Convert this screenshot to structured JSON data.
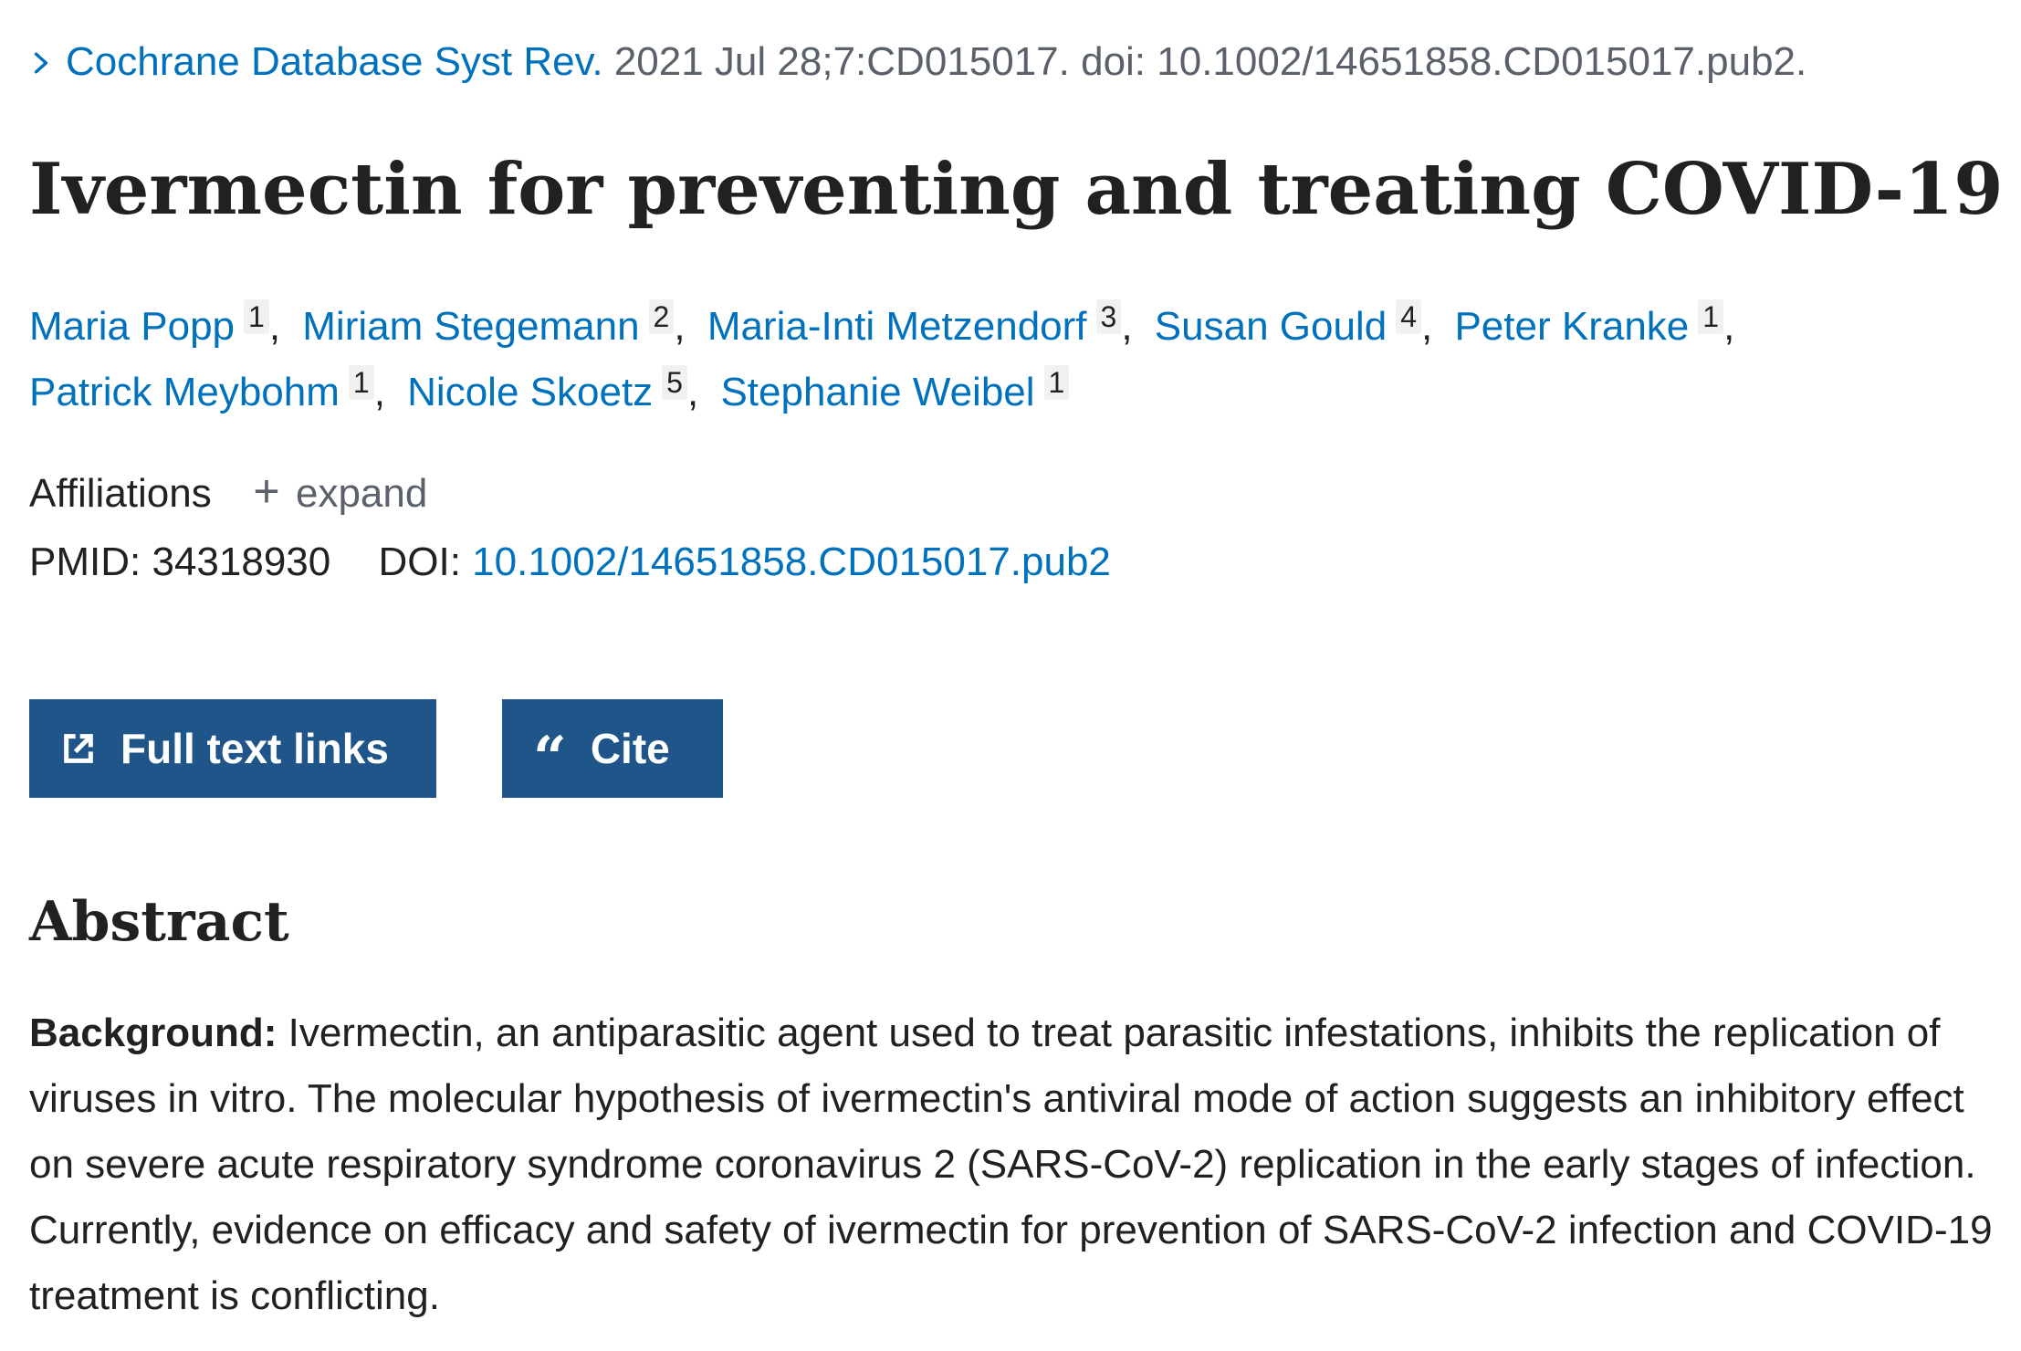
{
  "citation": {
    "journal": "Cochrane Database Syst Rev.",
    "details": "2021 Jul 28;7:CD015017. doi: 10.1002/14651858.CD015017.pub2."
  },
  "title": "Ivermectin for preventing and treating COVID-19",
  "authors": [
    {
      "name": "Maria Popp",
      "aff": "1"
    },
    {
      "name": "Miriam Stegemann",
      "aff": "2"
    },
    {
      "name": "Maria-Inti Metzendorf",
      "aff": "3"
    },
    {
      "name": "Susan Gould",
      "aff": "4"
    },
    {
      "name": "Peter Kranke",
      "aff": "1"
    },
    {
      "name": "Patrick Meybohm",
      "aff": "1"
    },
    {
      "name": "Nicole Skoetz",
      "aff": "5"
    },
    {
      "name": "Stephanie Weibel",
      "aff": "1"
    }
  ],
  "affiliations": {
    "label": "Affiliations",
    "toggle": "expand"
  },
  "identifiers": {
    "pmid_label": "PMID:",
    "pmid": "34318930",
    "doi_label": "DOI:",
    "doi": "10.1002/14651858.CD015017.pub2"
  },
  "buttons": {
    "full_text": "Full text links",
    "cite": "Cite"
  },
  "abstract": {
    "heading": "Abstract",
    "background_label": "Background:",
    "background_text": "Ivermectin, an antiparasitic agent used to treat parasitic infestations, inhibits the replication of viruses in vitro. The molecular hypothesis of ivermectin's antiviral mode of action suggests an inhibitory effect on severe acute respiratory syndrome coronavirus 2 (SARS-CoV-2) replication in the early stages of infection. Currently, evidence on efficacy and safety of ivermectin for prevention of SARS-CoV-2 infection and COVID-19 treatment is conflicting."
  },
  "colors": {
    "link": "#0071bc",
    "button_bg": "#20558a",
    "text": "#212121",
    "muted": "#5b616b"
  },
  "icons": {
    "journal": "chevron-right-icon",
    "full_text": "external-link-icon",
    "cite": "quote-icon",
    "affiliations": "plus-icon"
  }
}
